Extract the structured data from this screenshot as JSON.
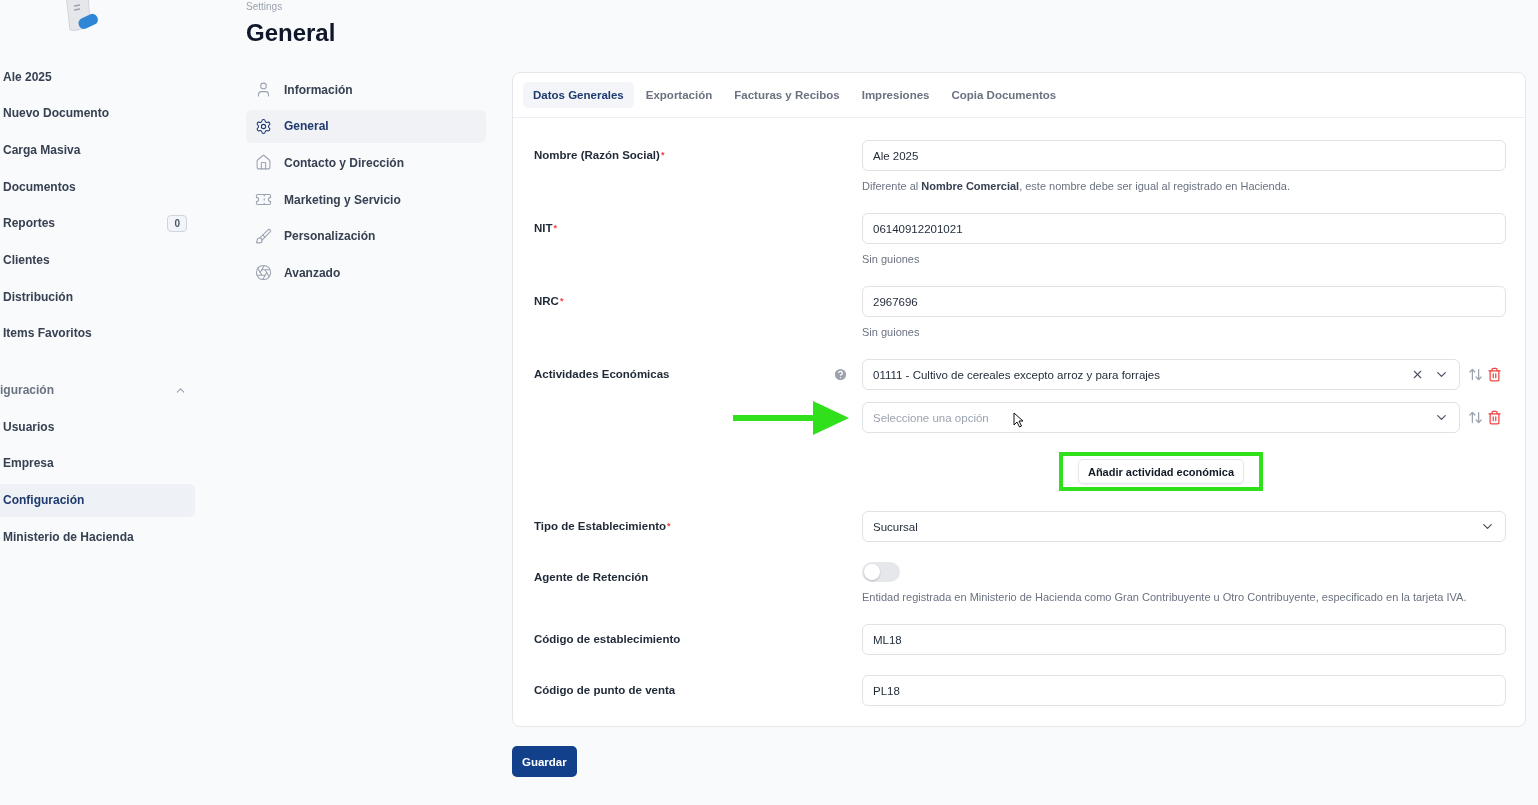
{
  "sidebar": {
    "items": [
      {
        "label": "Ale 2025",
        "selected": false
      },
      {
        "label": "Nuevo Documento",
        "selected": false
      },
      {
        "label": "Carga Masiva",
        "selected": false
      },
      {
        "label": "Documentos",
        "selected": false
      },
      {
        "label": "Reportes",
        "badge": "0",
        "selected": false
      },
      {
        "label": "Clientes",
        "selected": false
      },
      {
        "label": "Distribución",
        "selected": false
      },
      {
        "label": "Items Favoritos",
        "selected": false
      }
    ],
    "section": {
      "label": "iguración",
      "expanded": true,
      "items": [
        {
          "label": "Usuarios",
          "selected": false
        },
        {
          "label": "Empresa",
          "selected": false
        },
        {
          "label": "Configuración",
          "selected": true
        },
        {
          "label": "Ministerio de Hacienda",
          "selected": false
        }
      ]
    }
  },
  "settings_nav": {
    "breadcrumb": "Settings",
    "title": "General",
    "items": [
      {
        "label": "Información",
        "selected": false
      },
      {
        "label": "General",
        "selected": true
      },
      {
        "label": "Contacto y Dirección",
        "selected": false
      },
      {
        "label": "Marketing y Servicio",
        "selected": false
      },
      {
        "label": "Personalización",
        "selected": false
      },
      {
        "label": "Avanzado",
        "selected": false
      }
    ]
  },
  "tabs": [
    {
      "label": "Datos Generales",
      "selected": true
    },
    {
      "label": "Exportación",
      "selected": false
    },
    {
      "label": "Facturas y Recibos",
      "selected": false
    },
    {
      "label": "Impresiones",
      "selected": false
    },
    {
      "label": "Copia Documentos",
      "selected": false
    }
  ],
  "fields": [
    {
      "kind": "text",
      "label": "Nombre (Razón Social)",
      "required_mark": "*",
      "value": "Ale 2025",
      "help": "Diferente al **Nombre Comercial**, este nombre debe ser igual al registrado en Hacienda."
    },
    {
      "kind": "text",
      "label": "NIT",
      "required_mark": "*",
      "value": "06140912201021",
      "help": "Sin guiones"
    },
    {
      "kind": "text",
      "label": "NRC",
      "required_mark": "*",
      "value": "2967696",
      "help": "Sin guiones"
    },
    {
      "kind": "activities",
      "label": "Actividades Económicas",
      "entries": [
        {
          "value": "01111 - Cultivo de cereales excepto arroz y para forrajes"
        },
        {
          "placeholder": "Seleccione una opción"
        }
      ],
      "add_button": "Añadir actividad económica"
    },
    {
      "kind": "select",
      "label": "Tipo de Establecimiento",
      "required_mark": "*",
      "value": "Sucursal"
    },
    {
      "kind": "toggle",
      "label": "Agente de Retención",
      "on": false,
      "help": "Entidad registrada en Ministerio de Hacienda como Gran Contribuyente u Otro Contribuyente, especificado en la tarjeta IVA."
    },
    {
      "kind": "text",
      "label": "Código de establecimiento",
      "value": "ML18"
    },
    {
      "kind": "text",
      "label": "Código de punto de venta",
      "value": "PL18"
    }
  ],
  "save_button": "Guardar"
}
